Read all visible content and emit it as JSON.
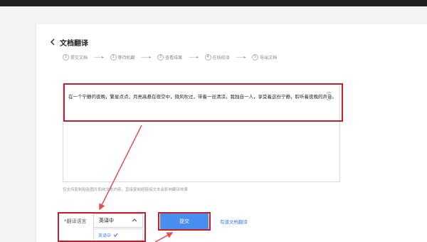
{
  "page": {
    "title": "文档翻译"
  },
  "steps": [
    {
      "num": "1",
      "label": "提交文档"
    },
    {
      "num": "2",
      "label": "等待机翻"
    },
    {
      "num": "3",
      "label": "查看结果"
    },
    {
      "num": "4",
      "label": "在线校译"
    },
    {
      "num": "5",
      "label": "导出文档"
    }
  ],
  "step_arrow": "——▸",
  "input": {
    "text": "在一个宁静的夜晚，繁星点点，月亮高悬在夜空中，微风吹过，带着一丝清凉。我独自一人，享受着这份宁静，聆听着夜晚的声音。"
  },
  "hint": "仅支持复制粘贴图片和纯文本内容，直接复制超链接文本会影响翻译效果",
  "language": {
    "label": "*翻译语言",
    "selected": "英译中",
    "option": "英译中"
  },
  "submit_label": "提交",
  "link_label": "有道文档翻译",
  "colors": {
    "accent": "#4a8ff0",
    "annotation": "#c0202a"
  }
}
